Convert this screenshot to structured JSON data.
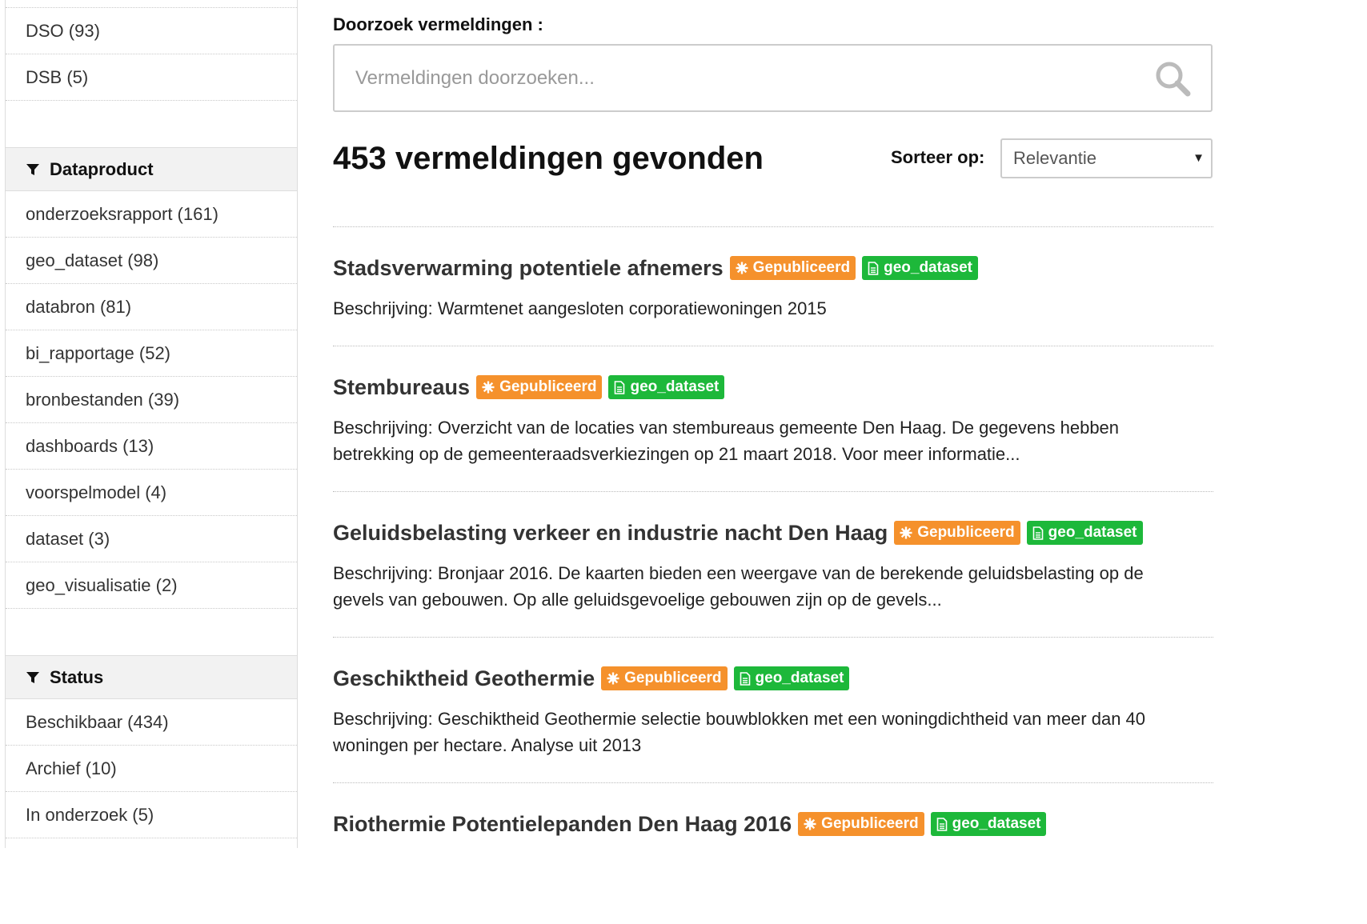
{
  "sidebar": {
    "top_items": [
      {
        "label": "DSO (93)"
      },
      {
        "label": "DSB (5)"
      }
    ],
    "facets": [
      {
        "title": "Dataproduct",
        "icon": "filter-icon",
        "items": [
          {
            "label": "onderzoeksrapport (161)"
          },
          {
            "label": "geo_dataset (98)"
          },
          {
            "label": "databron (81)"
          },
          {
            "label": "bi_rapportage (52)"
          },
          {
            "label": "bronbestanden (39)"
          },
          {
            "label": "dashboards (13)"
          },
          {
            "label": "voorspelmodel (4)"
          },
          {
            "label": "dataset (3)"
          },
          {
            "label": "geo_visualisatie (2)"
          }
        ]
      },
      {
        "title": "Status",
        "icon": "filter-icon",
        "items": [
          {
            "label": "Beschikbaar (434)"
          },
          {
            "label": "Archief (10)"
          },
          {
            "label": "In onderzoek (5)"
          }
        ]
      }
    ]
  },
  "search": {
    "label": "Doorzoek vermeldingen :",
    "placeholder": "Vermeldingen doorzoeken...",
    "value": "",
    "icon": "search-icon"
  },
  "results_header": {
    "count_text": "453 vermeldingen gevonden",
    "sort_label": "Sorteer op:",
    "sort_selected": "Relevantie",
    "sort_arrow": "▼"
  },
  "badge_colors": {
    "status": "#f5912c",
    "type": "#1db83a"
  },
  "results": [
    {
      "title": "Stadsverwarming potentiele afnemers",
      "status": "Gepubliceerd",
      "type": "geo_dataset",
      "description": "Beschrijving: Warmtenet aangesloten corporatiewoningen 2015"
    },
    {
      "title": "Stembureaus",
      "status": "Gepubliceerd",
      "type": "geo_dataset",
      "description": "Beschrijving: Overzicht van de locaties van stembureaus gemeente Den Haag. De gegevens hebben betrekking op de gemeenteraadsverkiezingen op 21 maart 2018. Voor meer informatie..."
    },
    {
      "title": "Geluidsbelasting verkeer en industrie nacht Den Haag",
      "status": "Gepubliceerd",
      "type": "geo_dataset",
      "description": "Beschrijving: Bronjaar 2016. De kaarten bieden een weergave van de berekende geluidsbelasting op de gevels van gebouwen. Op alle geluidsgevoelige gebouwen zijn op de gevels..."
    },
    {
      "title": "Geschiktheid Geothermie",
      "status": "Gepubliceerd",
      "type": "geo_dataset",
      "description": "Beschrijving: Geschiktheid Geothermie selectie bouwblokken met een woningdichtheid van meer dan 40 woningen per hectare. Analyse uit 2013"
    },
    {
      "title": "Riothermie Potentielepanden Den Haag 2016",
      "status": "Gepubliceerd",
      "type": "geo_dataset",
      "description": ""
    }
  ]
}
